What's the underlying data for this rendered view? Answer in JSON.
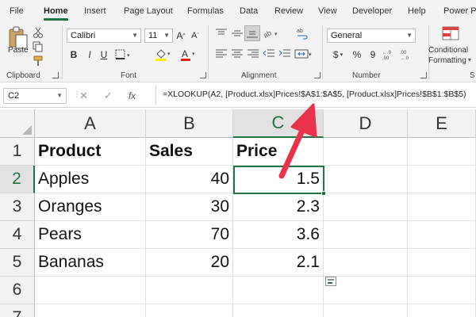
{
  "ribbon_tabs": [
    "File",
    "Home",
    "Insert",
    "Page Layout",
    "Formulas",
    "Data",
    "Review",
    "View",
    "Developer",
    "Help",
    "Power Pi"
  ],
  "active_tab": "Home",
  "clipboard": {
    "paste_label": "Paste",
    "group_label": "Clipboard"
  },
  "font": {
    "name": "Calibri",
    "size": "11",
    "bold": "B",
    "italic": "I",
    "underline": "U",
    "group_label": "Font"
  },
  "alignment": {
    "group_label": "Alignment"
  },
  "number": {
    "format": "General",
    "currency": "$",
    "percent": "%",
    "comma": "9",
    "group_label": "Number"
  },
  "styles": {
    "conditional_line1": "Conditional",
    "conditional_line2": "Formatting",
    "group_label": "S"
  },
  "formula_bar": {
    "name_box": "C2",
    "formula": "=XLOOKUP(A2, [Product.xlsx]Prices!$A$1:$A$5, [Product.xlsx]Prices!$B$1:$B$5)"
  },
  "columns": [
    "A",
    "B",
    "C",
    "D",
    "E"
  ],
  "rows": [
    "1",
    "2",
    "3",
    "4",
    "5",
    "6",
    "7"
  ],
  "selected_cell": "C2",
  "table": {
    "headers": [
      "Product",
      "Sales",
      "Price"
    ],
    "data": [
      [
        "Apples",
        "40",
        "1.5"
      ],
      [
        "Oranges",
        "30",
        "2.3"
      ],
      [
        "Pears",
        "70",
        "3.6"
      ],
      [
        "Bananas",
        "20",
        "2.1"
      ]
    ]
  },
  "colors": {
    "accent": "#217346",
    "arrow": "#e8324a"
  }
}
